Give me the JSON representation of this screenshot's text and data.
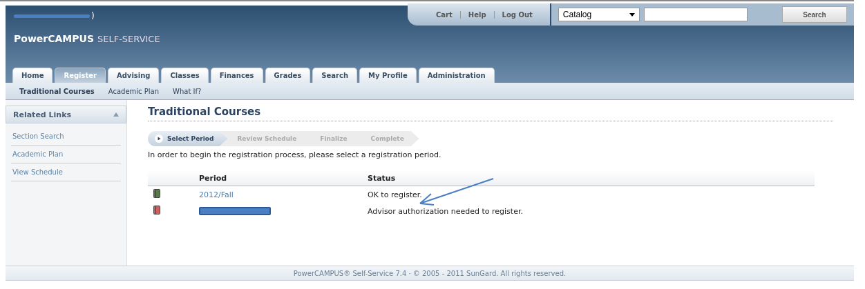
{
  "header": {
    "welcome_suffix": ")",
    "logo": {
      "brand": "PowerCAMPUS",
      "suffix": "SELF-SERVICE"
    },
    "links": [
      "Cart",
      "Help",
      "Log Out"
    ],
    "search": {
      "scope": "Catalog",
      "button": "Search"
    }
  },
  "tabs": [
    {
      "label": "Home",
      "selected": false
    },
    {
      "label": "Register",
      "selected": true
    },
    {
      "label": "Advising",
      "selected": false
    },
    {
      "label": "Classes",
      "selected": false
    },
    {
      "label": "Finances",
      "selected": false
    },
    {
      "label": "Grades",
      "selected": false
    },
    {
      "label": "Search",
      "selected": false
    },
    {
      "label": "My Profile",
      "selected": false
    },
    {
      "label": "Administration",
      "selected": false
    }
  ],
  "subnav": [
    {
      "label": "Traditional Courses",
      "selected": true
    },
    {
      "label": "Academic Plan",
      "selected": false
    },
    {
      "label": "What If?",
      "selected": false
    }
  ],
  "sidebar": {
    "title": "Related Links",
    "expanded": true,
    "items": [
      "Section Search",
      "Academic Plan",
      "View Schedule"
    ]
  },
  "content": {
    "title": "Traditional Courses",
    "steps": [
      {
        "label": "Select Period",
        "selected": true
      },
      {
        "label": "Review Schedule",
        "selected": false
      },
      {
        "label": "Finalize",
        "selected": false
      },
      {
        "label": "Complete",
        "selected": false
      }
    ],
    "instruction": "In order to begin the registration process, please select a registration period.",
    "table": {
      "columns": [
        "Period",
        "Status"
      ],
      "rows": [
        {
          "kind": "link",
          "period": "2012/Fall",
          "status": "OK to register.",
          "color": "#5a7a4a"
        },
        {
          "kind": "redacted",
          "status": "Advisor authorization needed to register.",
          "color": "#d06060"
        }
      ]
    }
  },
  "footer": "PowerCAMPUS® Self-Service 7.4 · © 2005 - 2011 SunGard. All rights reserved."
}
